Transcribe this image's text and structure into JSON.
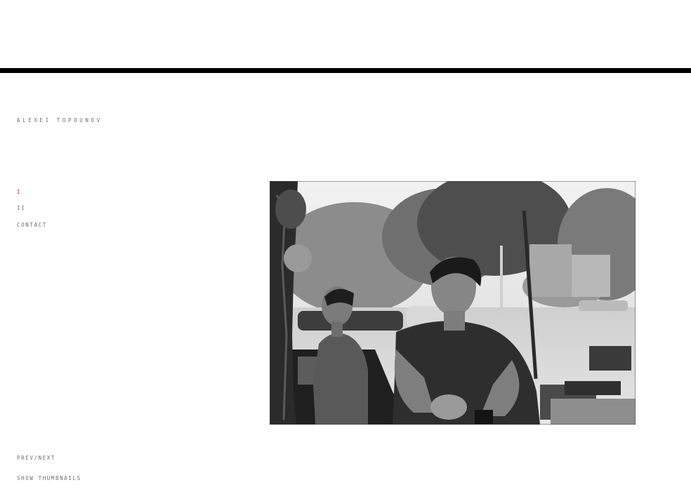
{
  "site": {
    "title": "ALEXEI TOPOUNOV"
  },
  "nav": {
    "items": [
      {
        "label": "I",
        "active": true
      },
      {
        "label": "II",
        "active": false
      },
      {
        "label": "CONTACT",
        "active": false
      }
    ]
  },
  "footer": {
    "prev_next": "PREV/NEXT",
    "thumbnails": "SHOW THUMBNAILS"
  },
  "photo": {
    "style": "black-and-white street portrait"
  },
  "colors": {
    "accent": "#c2305a",
    "text": "#6e6e6e",
    "rule": "#000000",
    "background": "#ffffff"
  }
}
